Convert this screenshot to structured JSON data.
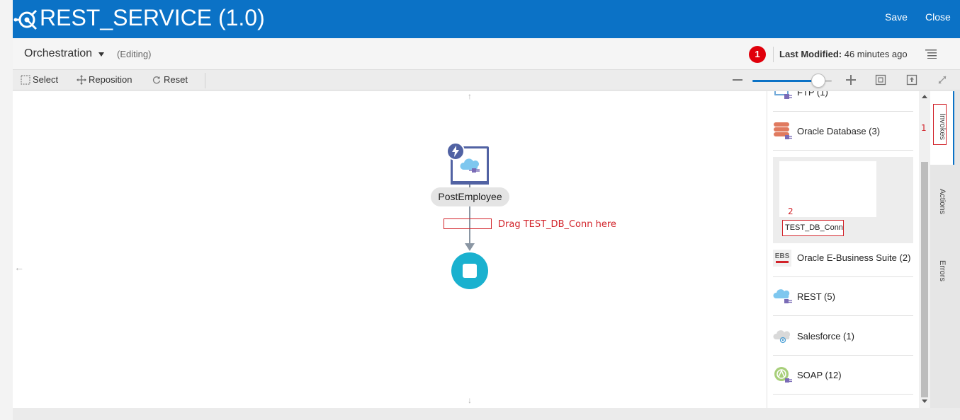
{
  "header": {
    "title": "REST_SERVICE (1.0)",
    "save_label": "Save",
    "close_label": "Close",
    "bg_color": "#0b72c6"
  },
  "subheader": {
    "mode": "Orchestration",
    "status": "(Editing)",
    "notification_count": "1",
    "last_modified_label": "Last Modified:",
    "last_modified_value": "46 minutes ago"
  },
  "toolbar": {
    "select_label": "Select",
    "reposition_label": "Reposition",
    "reset_label": "Reset",
    "zoom_level": 0.83
  },
  "canvas": {
    "trigger_name": "PostEmployee",
    "drag_hint": "Drag TEST_DB_Conn here"
  },
  "palette": {
    "items": [
      {
        "label": "FTP (1)",
        "icon": "ftp-icon"
      },
      {
        "label": "Oracle Database (3)",
        "icon": "oracle-database-icon"
      },
      {
        "label": "Oracle E-Business Suite (2)",
        "icon": "ebs-icon"
      },
      {
        "label": "REST (5)",
        "icon": "rest-cloud-icon"
      },
      {
        "label": "Salesforce (1)",
        "icon": "salesforce-cloud-icon"
      },
      {
        "label": "SOAP (12)",
        "icon": "soap-icon"
      }
    ],
    "expanded_connection": "TEST_DB_Conn",
    "annotation_2": "2"
  },
  "vtabs": {
    "invokes": "Invokes",
    "actions": "Actions",
    "errors": "Errors",
    "annotation_1": "1"
  }
}
